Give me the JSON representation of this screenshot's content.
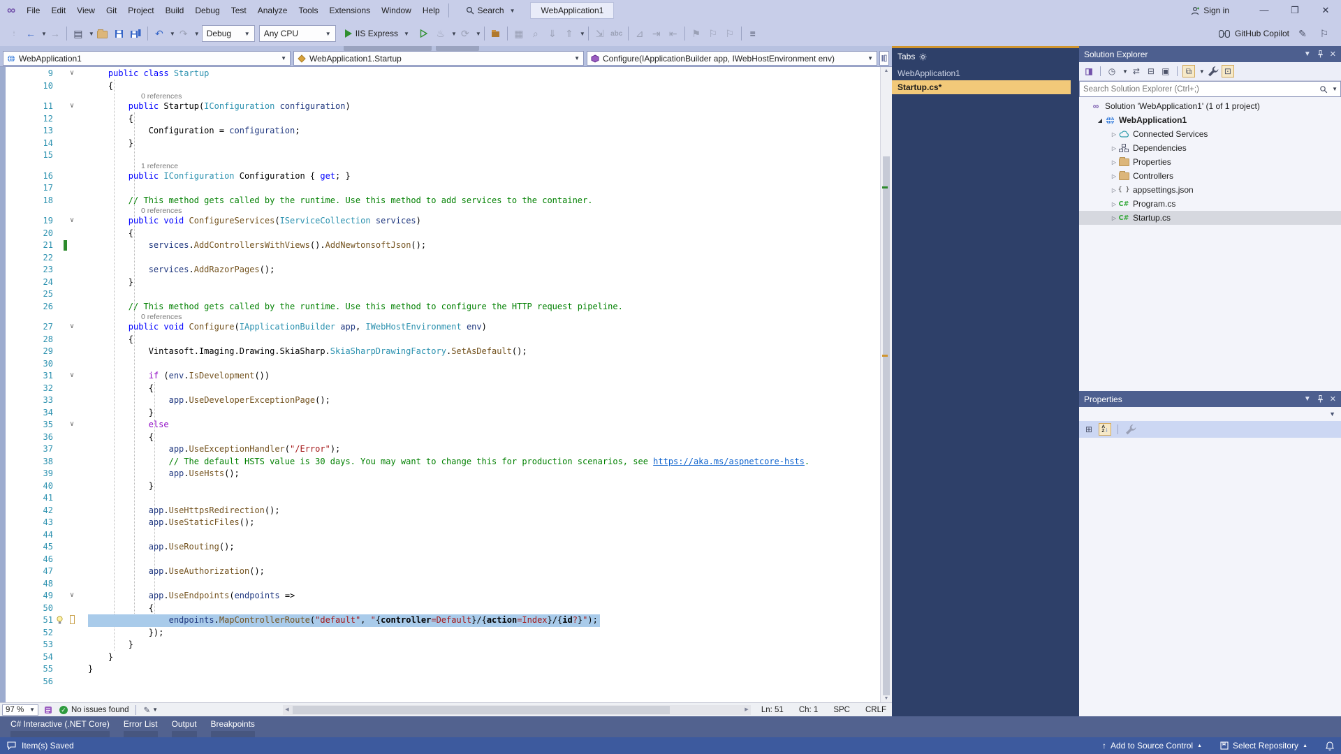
{
  "window": {
    "badge": "WebApplication1",
    "sign_in": "Sign in",
    "minimize": "—",
    "restore": "❐",
    "close": "✕"
  },
  "menus": [
    "File",
    "Edit",
    "View",
    "Git",
    "Project",
    "Build",
    "Debug",
    "Test",
    "Analyze",
    "Tools",
    "Extensions",
    "Window",
    "Help"
  ],
  "search": {
    "label": "Search"
  },
  "toolbar": {
    "debug_config": "Debug",
    "platform": "Any CPU",
    "run": "IIS Express",
    "copilot": "GitHub Copilot",
    "icons": [
      "navigate-back",
      "navigate-forward",
      "new-project",
      "open-file",
      "save",
      "save-all",
      "undo",
      "redo",
      "start-debug",
      "start-without-debug",
      "hot-reload",
      "restart",
      "package",
      "window-layout",
      "indent",
      "comment",
      "spell-check",
      "bookmark",
      "task-list"
    ]
  },
  "navbar": {
    "project": "WebApplication1",
    "type": "WebApplication1.Startup",
    "member": "Configure(IApplicationBuilder app, IWebHostEnvironment env)"
  },
  "editor": {
    "rows": [
      {
        "k": "code",
        "n": 9,
        "fold": 1,
        "s": [
          [
            "n",
            "    "
          ],
          [
            "k",
            "public class "
          ],
          [
            "t",
            "Startup"
          ]
        ]
      },
      {
        "k": "code",
        "n": 10,
        "s": [
          [
            "n",
            "    {"
          ]
        ]
      },
      {
        "k": "lens",
        "t": "0 references"
      },
      {
        "k": "code",
        "n": 11,
        "fold": 1,
        "s": [
          [
            "n",
            "        "
          ],
          [
            "k",
            "public "
          ],
          [
            "n",
            "Startup("
          ],
          [
            "t",
            "IConfiguration"
          ],
          [
            "n",
            " "
          ],
          [
            "p",
            "configuration"
          ],
          [
            "n",
            ")"
          ]
        ]
      },
      {
        "k": "code",
        "n": 12,
        "s": [
          [
            "n",
            "        {"
          ]
        ]
      },
      {
        "k": "code",
        "n": 13,
        "s": [
          [
            "n",
            "            Configuration = "
          ],
          [
            "p",
            "configuration"
          ],
          [
            "n",
            ";"
          ]
        ]
      },
      {
        "k": "code",
        "n": 14,
        "s": [
          [
            "n",
            "        }"
          ]
        ]
      },
      {
        "k": "code",
        "n": 15,
        "s": []
      },
      {
        "k": "lens",
        "t": "1 reference"
      },
      {
        "k": "code",
        "n": 16,
        "s": [
          [
            "n",
            "        "
          ],
          [
            "k",
            "public "
          ],
          [
            "t",
            "IConfiguration"
          ],
          [
            "n",
            " Configuration { "
          ],
          [
            "k",
            "get"
          ],
          [
            "n",
            "; }"
          ]
        ]
      },
      {
        "k": "code",
        "n": 17,
        "s": []
      },
      {
        "k": "code",
        "n": 18,
        "s": [
          [
            "cm",
            "        // This method gets called by the runtime. Use this method to add services to the container."
          ]
        ]
      },
      {
        "k": "lens",
        "t": "0 references"
      },
      {
        "k": "code",
        "n": 19,
        "fold": 1,
        "s": [
          [
            "n",
            "        "
          ],
          [
            "k",
            "public void "
          ],
          [
            "m",
            "ConfigureServices"
          ],
          [
            "n",
            "("
          ],
          [
            "t",
            "IServiceCollection"
          ],
          [
            "n",
            " "
          ],
          [
            "p",
            "services"
          ],
          [
            "n",
            ")"
          ]
        ]
      },
      {
        "k": "code",
        "n": 20,
        "s": [
          [
            "n",
            "        {"
          ]
        ]
      },
      {
        "k": "code",
        "n": 21,
        "g": "change",
        "s": [
          [
            "n",
            "            "
          ],
          [
            "p",
            "services"
          ],
          [
            "n",
            "."
          ],
          [
            "m",
            "AddControllersWithViews"
          ],
          [
            "n",
            "()."
          ],
          [
            "m",
            "AddNewtonsoftJson"
          ],
          [
            "n",
            "();"
          ]
        ]
      },
      {
        "k": "code",
        "n": 22,
        "s": []
      },
      {
        "k": "code",
        "n": 23,
        "s": [
          [
            "n",
            "            "
          ],
          [
            "p",
            "services"
          ],
          [
            "n",
            "."
          ],
          [
            "m",
            "AddRazorPages"
          ],
          [
            "n",
            "();"
          ]
        ]
      },
      {
        "k": "code",
        "n": 24,
        "s": [
          [
            "n",
            "        }"
          ]
        ]
      },
      {
        "k": "code",
        "n": 25,
        "s": []
      },
      {
        "k": "code",
        "n": 26,
        "s": [
          [
            "cm",
            "        // This method gets called by the runtime. Use this method to configure the HTTP request pipeline."
          ]
        ]
      },
      {
        "k": "lens",
        "t": "0 references"
      },
      {
        "k": "code",
        "n": 27,
        "fold": 1,
        "s": [
          [
            "n",
            "        "
          ],
          [
            "k",
            "public void "
          ],
          [
            "m",
            "Configure"
          ],
          [
            "n",
            "("
          ],
          [
            "t",
            "IApplicationBuilder"
          ],
          [
            "n",
            " "
          ],
          [
            "p",
            "app"
          ],
          [
            "n",
            ", "
          ],
          [
            "t",
            "IWebHostEnvironment"
          ],
          [
            "n",
            " "
          ],
          [
            "p",
            "env"
          ],
          [
            "n",
            ")"
          ]
        ]
      },
      {
        "k": "code",
        "n": 28,
        "s": [
          [
            "n",
            "        {"
          ]
        ]
      },
      {
        "k": "code",
        "n": 29,
        "s": [
          [
            "n",
            "            Vintasoft.Imaging.Drawing.SkiaSharp."
          ],
          [
            "t",
            "SkiaSharpDrawingFactory"
          ],
          [
            "n",
            "."
          ],
          [
            "m",
            "SetAsDefault"
          ],
          [
            "n",
            "();"
          ]
        ]
      },
      {
        "k": "code",
        "n": 30,
        "s": []
      },
      {
        "k": "code",
        "n": 31,
        "fold": 1,
        "s": [
          [
            "n",
            "            "
          ],
          [
            "c",
            "if"
          ],
          [
            "n",
            " ("
          ],
          [
            "p",
            "env"
          ],
          [
            "n",
            "."
          ],
          [
            "m",
            "IsDevelopment"
          ],
          [
            "n",
            "())"
          ]
        ]
      },
      {
        "k": "code",
        "n": 32,
        "s": [
          [
            "n",
            "            {"
          ]
        ]
      },
      {
        "k": "code",
        "n": 33,
        "s": [
          [
            "n",
            "                "
          ],
          [
            "p",
            "app"
          ],
          [
            "n",
            "."
          ],
          [
            "m",
            "UseDeveloperExceptionPage"
          ],
          [
            "n",
            "();"
          ]
        ]
      },
      {
        "k": "code",
        "n": 34,
        "s": [
          [
            "n",
            "            }"
          ]
        ]
      },
      {
        "k": "code",
        "n": 35,
        "fold": 1,
        "s": [
          [
            "n",
            "            "
          ],
          [
            "c",
            "else"
          ]
        ]
      },
      {
        "k": "code",
        "n": 36,
        "s": [
          [
            "n",
            "            {"
          ]
        ]
      },
      {
        "k": "code",
        "n": 37,
        "s": [
          [
            "n",
            "                "
          ],
          [
            "p",
            "app"
          ],
          [
            "n",
            "."
          ],
          [
            "m",
            "UseExceptionHandler"
          ],
          [
            "n",
            "("
          ],
          [
            "s",
            "\"/Error\""
          ],
          [
            "n",
            ");"
          ]
        ]
      },
      {
        "k": "code",
        "n": 38,
        "s": [
          [
            "cm",
            "                // The default HSTS value is 30 days. You may want to change this for production scenarios, see "
          ],
          [
            "a",
            "https://aka.ms/aspnetcore-hsts"
          ],
          [
            "cm",
            "."
          ]
        ]
      },
      {
        "k": "code",
        "n": 39,
        "s": [
          [
            "n",
            "                "
          ],
          [
            "p",
            "app"
          ],
          [
            "n",
            "."
          ],
          [
            "m",
            "UseHsts"
          ],
          [
            "n",
            "();"
          ]
        ]
      },
      {
        "k": "code",
        "n": 40,
        "s": [
          [
            "n",
            "            }"
          ]
        ]
      },
      {
        "k": "code",
        "n": 41,
        "s": []
      },
      {
        "k": "code",
        "n": 42,
        "s": [
          [
            "n",
            "            "
          ],
          [
            "p",
            "app"
          ],
          [
            "n",
            "."
          ],
          [
            "m",
            "UseHttpsRedirection"
          ],
          [
            "n",
            "();"
          ]
        ]
      },
      {
        "k": "code",
        "n": 43,
        "s": [
          [
            "n",
            "            "
          ],
          [
            "p",
            "app"
          ],
          [
            "n",
            "."
          ],
          [
            "m",
            "UseStaticFiles"
          ],
          [
            "n",
            "();"
          ]
        ]
      },
      {
        "k": "code",
        "n": 44,
        "s": []
      },
      {
        "k": "code",
        "n": 45,
        "s": [
          [
            "n",
            "            "
          ],
          [
            "p",
            "app"
          ],
          [
            "n",
            "."
          ],
          [
            "m",
            "UseRouting"
          ],
          [
            "n",
            "();"
          ]
        ]
      },
      {
        "k": "code",
        "n": 46,
        "s": []
      },
      {
        "k": "code",
        "n": 47,
        "s": [
          [
            "n",
            "            "
          ],
          [
            "p",
            "app"
          ],
          [
            "n",
            "."
          ],
          [
            "m",
            "UseAuthorization"
          ],
          [
            "n",
            "();"
          ]
        ]
      },
      {
        "k": "code",
        "n": 48,
        "s": []
      },
      {
        "k": "code",
        "n": 49,
        "fold": 1,
        "s": [
          [
            "n",
            "            "
          ],
          [
            "p",
            "app"
          ],
          [
            "n",
            "."
          ],
          [
            "m",
            "UseEndpoints"
          ],
          [
            "n",
            "("
          ],
          [
            "p",
            "endpoints"
          ],
          [
            "n",
            " =>"
          ]
        ]
      },
      {
        "k": "code",
        "n": 50,
        "s": [
          [
            "n",
            "            {"
          ]
        ]
      },
      {
        "k": "code",
        "n": 51,
        "g": "bulb",
        "bracket": 1,
        "sel": 1,
        "s": [
          [
            "n",
            "                "
          ],
          [
            "p",
            "endpoints"
          ],
          [
            "n",
            "."
          ],
          [
            "m",
            "MapControllerRoute"
          ],
          [
            "n",
            "("
          ],
          [
            "s",
            "\"default\""
          ],
          [
            "n",
            ", "
          ],
          [
            "s",
            "\""
          ],
          [
            "n",
            "{"
          ],
          [
            "b",
            "controller"
          ],
          [
            "s",
            "=Default"
          ],
          [
            "n",
            "}/{"
          ],
          [
            "b",
            "action"
          ],
          [
            "s",
            "=Index"
          ],
          [
            "n",
            "}/{"
          ],
          [
            "b",
            "id"
          ],
          [
            "s",
            "?"
          ],
          [
            "n",
            "}"
          ],
          [
            "s",
            "\""
          ],
          [
            "n",
            ");"
          ]
        ]
      },
      {
        "k": "code",
        "n": 52,
        "s": [
          [
            "n",
            "            });"
          ]
        ]
      },
      {
        "k": "code",
        "n": 53,
        "s": [
          [
            "n",
            "        }"
          ]
        ]
      },
      {
        "k": "code",
        "n": 54,
        "s": [
          [
            "n",
            "    }"
          ]
        ]
      },
      {
        "k": "code",
        "n": 55,
        "s": [
          [
            "n",
            "}"
          ]
        ]
      },
      {
        "k": "code",
        "n": 56,
        "s": []
      }
    ]
  },
  "tabs_panel": {
    "title": "Tabs",
    "group": "WebApplication1",
    "doc": "Startup.cs*"
  },
  "solution_explorer": {
    "title": "Solution Explorer",
    "search_placeholder": "Search Solution Explorer (Ctrl+;)",
    "toolbar_icons": [
      "switch-views",
      "pending-changes",
      "sync",
      "collapse-all",
      "properties",
      "show-all-files",
      "wrench",
      "preview-selected"
    ],
    "tree": [
      {
        "icon": "solution",
        "label": "Solution 'WebApplication1' (1 of 1 project)",
        "indent": 0
      },
      {
        "icon": "project",
        "label": "WebApplication1",
        "indent": 1,
        "arrow": "open",
        "bold": true
      },
      {
        "icon": "cloud",
        "label": "Connected Services",
        "indent": 2,
        "arrow": "closed"
      },
      {
        "icon": "dependencies",
        "label": "Dependencies",
        "indent": 2,
        "arrow": "closed"
      },
      {
        "icon": "folder-props",
        "label": "Properties",
        "indent": 2,
        "arrow": "closed"
      },
      {
        "icon": "folder",
        "label": "Controllers",
        "indent": 2,
        "arrow": "closed"
      },
      {
        "icon": "json",
        "label": "appsettings.json",
        "indent": 2,
        "arrow": "closed"
      },
      {
        "icon": "csharp",
        "label": "Program.cs",
        "indent": 2,
        "arrow": "closed"
      },
      {
        "icon": "csharp",
        "label": "Startup.cs",
        "indent": 2,
        "arrow": "closed",
        "selected": true
      }
    ]
  },
  "properties_panel": {
    "title": "Properties"
  },
  "editor_status": {
    "zoom": "97 %",
    "issues": "No issues found",
    "ln": "Ln: 51",
    "ch": "Ch: 1",
    "spc": "SPC",
    "eol": "CRLF"
  },
  "bottom_tabs": [
    "C# Interactive (.NET Core)",
    "Error List",
    "Output",
    "Breakpoints"
  ],
  "status_bar": {
    "message": "Item(s) Saved",
    "source_control": "Add to Source Control",
    "repository": "Select Repository"
  },
  "colors": {
    "title_bar": "#c8cee9",
    "doc_well": "#2e4069",
    "active_doc_highlight": "#f2c979",
    "panel_header": "#4d5f8f",
    "status_bar": "#3d5a9e",
    "selection": "#a9cbea",
    "line_number": "#2b91af",
    "keyword": "#0000ff",
    "control_keyword": "#8f08c4",
    "type": "#2b91af",
    "string": "#a31515",
    "comment": "#008000",
    "method": "#74531f",
    "run_green": "#2f8f2f",
    "change_bar_green": "#2c8a2c"
  }
}
